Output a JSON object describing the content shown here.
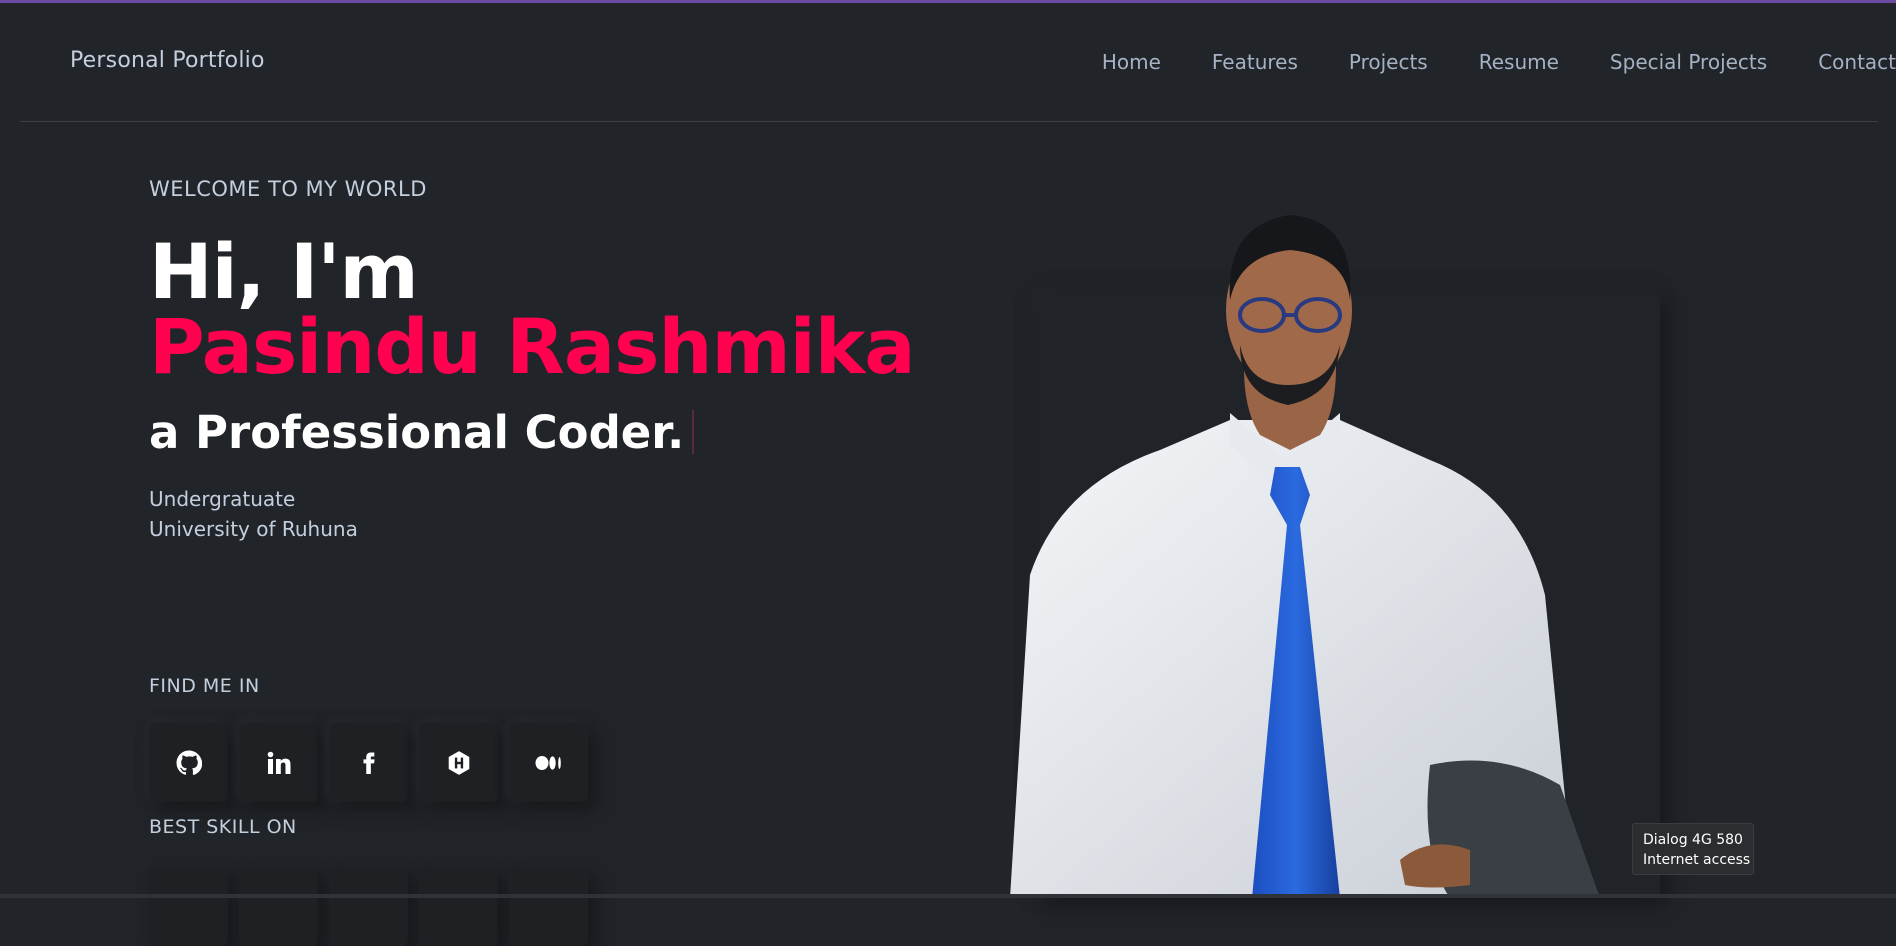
{
  "header": {
    "brand": "Personal Portfolio",
    "nav": [
      "Home",
      "Features",
      "Projects",
      "Resume",
      "Special Projects",
      "Contact"
    ]
  },
  "hero": {
    "welcome": "WELCOME TO MY WORLD",
    "greeting": "Hi, I'm",
    "name": "Pasindu Rashmika",
    "role": "a Professional Coder.",
    "education_line1": "Undergratuate",
    "education_line2": "University of Ruhuna",
    "find_me_label": "FIND ME IN",
    "social_icons": [
      "github-icon",
      "linkedin-icon",
      "facebook-icon",
      "hashnode-icon",
      "medium-icon"
    ],
    "best_skill_label": "BEST SKILL ON"
  },
  "network_toast": {
    "line1": "Dialog 4G 580",
    "line2": "Internet access"
  },
  "colors": {
    "background": "#212428",
    "accent": "#ff014f",
    "text": "#c4cfde",
    "heading": "#ffffff"
  }
}
